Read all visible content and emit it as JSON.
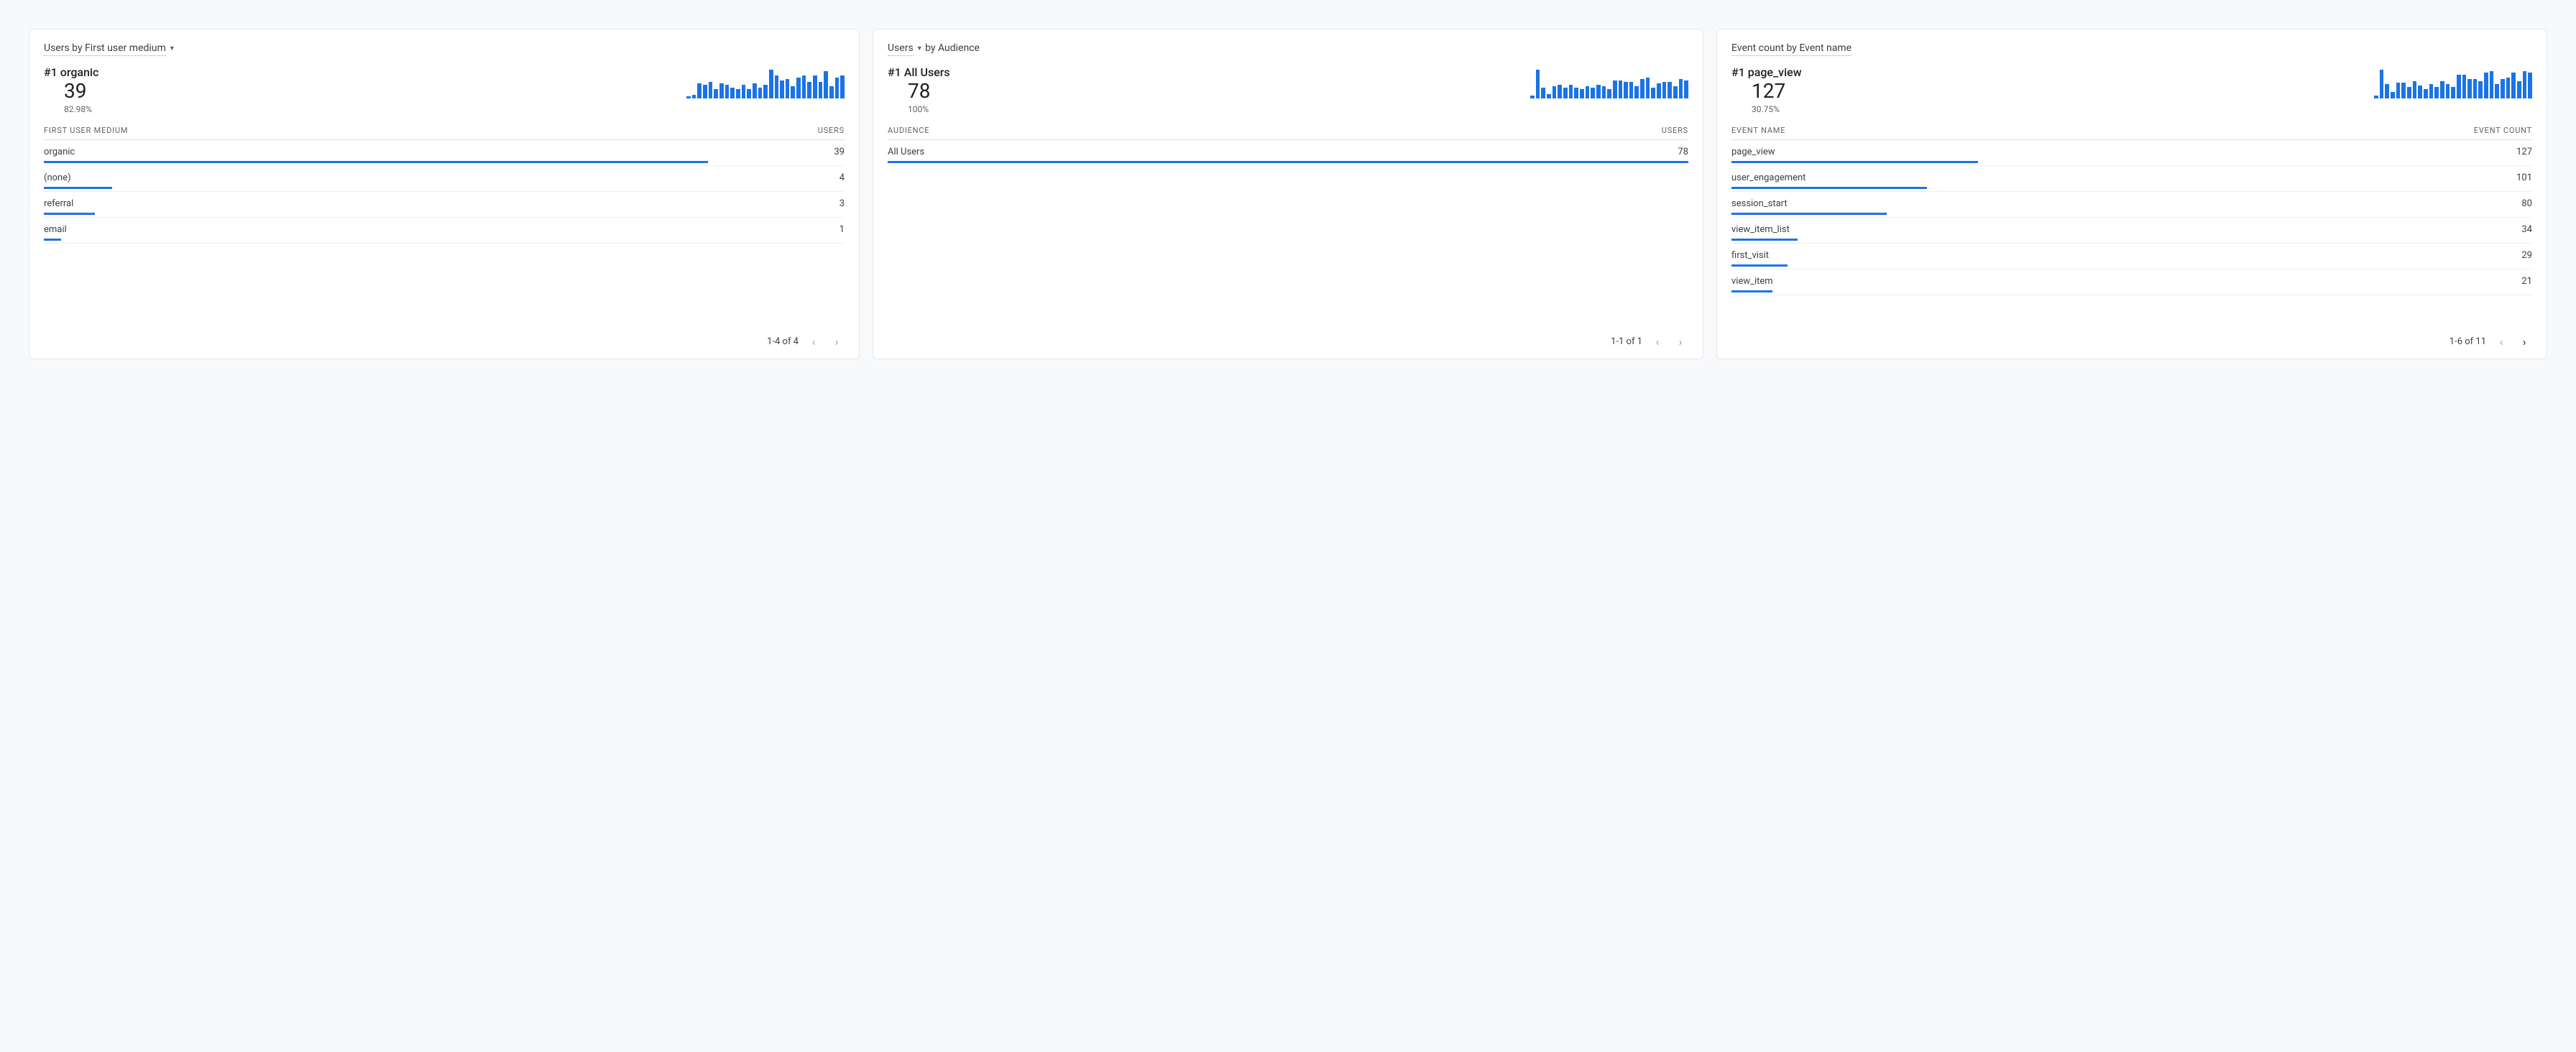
{
  "cards": [
    {
      "title_parts": [
        "Users by",
        "First user medium"
      ],
      "title_dropdown_on": "last",
      "hero": {
        "rank": "#1",
        "label": "organic",
        "value": "39",
        "pct": "82.98%"
      },
      "spark": [
        3,
        5,
        20,
        18,
        22,
        12,
        20,
        18,
        14,
        12,
        18,
        12,
        20,
        14,
        18,
        38,
        30,
        24,
        26,
        16,
        28,
        30,
        22,
        30,
        22,
        36,
        16,
        28,
        30
      ],
      "thead": {
        "left": "FIRST USER MEDIUM",
        "right": "USERS"
      },
      "rows": [
        {
          "label": "organic",
          "value": "39",
          "pct": 82.98
        },
        {
          "label": "(none)",
          "value": "4",
          "pct": 8.51
        },
        {
          "label": "referral",
          "value": "3",
          "pct": 6.38
        },
        {
          "label": "email",
          "value": "1",
          "pct": 2.13
        }
      ],
      "pager": {
        "text": "1-4 of 4",
        "prev": false,
        "next": false
      }
    },
    {
      "title_parts": [
        "Users",
        "by Audience"
      ],
      "title_dropdown_on": "first",
      "hero": {
        "rank": "#1",
        "label": "All Users",
        "value": "78",
        "pct": "100%"
      },
      "spark": [
        4,
        38,
        14,
        6,
        16,
        18,
        14,
        18,
        14,
        12,
        16,
        14,
        18,
        16,
        12,
        24,
        24,
        22,
        22,
        16,
        26,
        28,
        14,
        20,
        22,
        22,
        16,
        26,
        24
      ],
      "thead": {
        "left": "AUDIENCE",
        "right": "USERS"
      },
      "rows": [
        {
          "label": "All Users",
          "value": "78",
          "pct": 100
        }
      ],
      "pager": {
        "text": "1-1 of 1",
        "prev": false,
        "next": false
      }
    },
    {
      "title_parts": [
        "Event count by",
        "Event name"
      ],
      "title_dropdown_on": "none",
      "hero": {
        "rank": "#1",
        "label": "page_view",
        "value": "127",
        "pct": "30.75%"
      },
      "spark": [
        4,
        36,
        18,
        8,
        20,
        20,
        14,
        22,
        16,
        12,
        18,
        14,
        22,
        18,
        14,
        30,
        30,
        24,
        24,
        22,
        32,
        34,
        18,
        24,
        26,
        32,
        22,
        34,
        32
      ],
      "thead": {
        "left": "EVENT NAME",
        "right": "EVENT COUNT"
      },
      "rows": [
        {
          "label": "page_view",
          "value": "127",
          "pct": 30.75
        },
        {
          "label": "user_engagement",
          "value": "101",
          "pct": 24.45
        },
        {
          "label": "session_start",
          "value": "80",
          "pct": 19.37
        },
        {
          "label": "view_item_list",
          "value": "34",
          "pct": 8.23
        },
        {
          "label": "first_visit",
          "value": "29",
          "pct": 7.02
        },
        {
          "label": "view_item",
          "value": "21",
          "pct": 5.08
        }
      ],
      "pager": {
        "text": "1-6 of 11",
        "prev": false,
        "next": true
      }
    }
  ],
  "chart_data": [
    {
      "type": "bar",
      "title": "#1 organic sparkline (Users by First user medium)",
      "categories": [
        1,
        2,
        3,
        4,
        5,
        6,
        7,
        8,
        9,
        10,
        11,
        12,
        13,
        14,
        15,
        16,
        17,
        18,
        19,
        20,
        21,
        22,
        23,
        24,
        25,
        26,
        27,
        28,
        29
      ],
      "values": [
        3,
        5,
        20,
        18,
        22,
        12,
        20,
        18,
        14,
        12,
        18,
        12,
        20,
        14,
        18,
        38,
        30,
        24,
        26,
        16,
        28,
        30,
        22,
        30,
        22,
        36,
        16,
        28,
        30
      ],
      "ylabel": "Users"
    },
    {
      "type": "bar",
      "title": "#1 All Users sparkline (Users by Audience)",
      "categories": [
        1,
        2,
        3,
        4,
        5,
        6,
        7,
        8,
        9,
        10,
        11,
        12,
        13,
        14,
        15,
        16,
        17,
        18,
        19,
        20,
        21,
        22,
        23,
        24,
        25,
        26,
        27,
        28,
        29
      ],
      "values": [
        4,
        38,
        14,
        6,
        16,
        18,
        14,
        18,
        14,
        12,
        16,
        14,
        18,
        16,
        12,
        24,
        24,
        22,
        22,
        16,
        26,
        28,
        14,
        20,
        22,
        22,
        16,
        26,
        24
      ],
      "ylabel": "Users"
    },
    {
      "type": "bar",
      "title": "#1 page_view sparkline (Event count by Event name)",
      "categories": [
        1,
        2,
        3,
        4,
        5,
        6,
        7,
        8,
        9,
        10,
        11,
        12,
        13,
        14,
        15,
        16,
        17,
        18,
        19,
        20,
        21,
        22,
        23,
        24,
        25,
        26,
        27,
        28,
        29
      ],
      "values": [
        4,
        36,
        18,
        8,
        20,
        20,
        14,
        22,
        16,
        12,
        18,
        14,
        22,
        18,
        14,
        30,
        30,
        24,
        24,
        22,
        32,
        34,
        18,
        24,
        26,
        32,
        22,
        34,
        32
      ],
      "ylabel": "Event count"
    },
    {
      "type": "table",
      "title": "Users by First user medium",
      "columns": [
        "FIRST USER MEDIUM",
        "USERS"
      ],
      "rows": [
        [
          "organic",
          39
        ],
        [
          "(none)",
          4
        ],
        [
          "referral",
          3
        ],
        [
          "email",
          1
        ]
      ]
    },
    {
      "type": "table",
      "title": "Users by Audience",
      "columns": [
        "AUDIENCE",
        "USERS"
      ],
      "rows": [
        [
          "All Users",
          78
        ]
      ]
    },
    {
      "type": "table",
      "title": "Event count by Event name",
      "columns": [
        "EVENT NAME",
        "EVENT COUNT"
      ],
      "rows": [
        [
          "page_view",
          127
        ],
        [
          "user_engagement",
          101
        ],
        [
          "session_start",
          80
        ],
        [
          "view_item_list",
          34
        ],
        [
          "first_visit",
          29
        ],
        [
          "view_item",
          21
        ]
      ]
    }
  ]
}
